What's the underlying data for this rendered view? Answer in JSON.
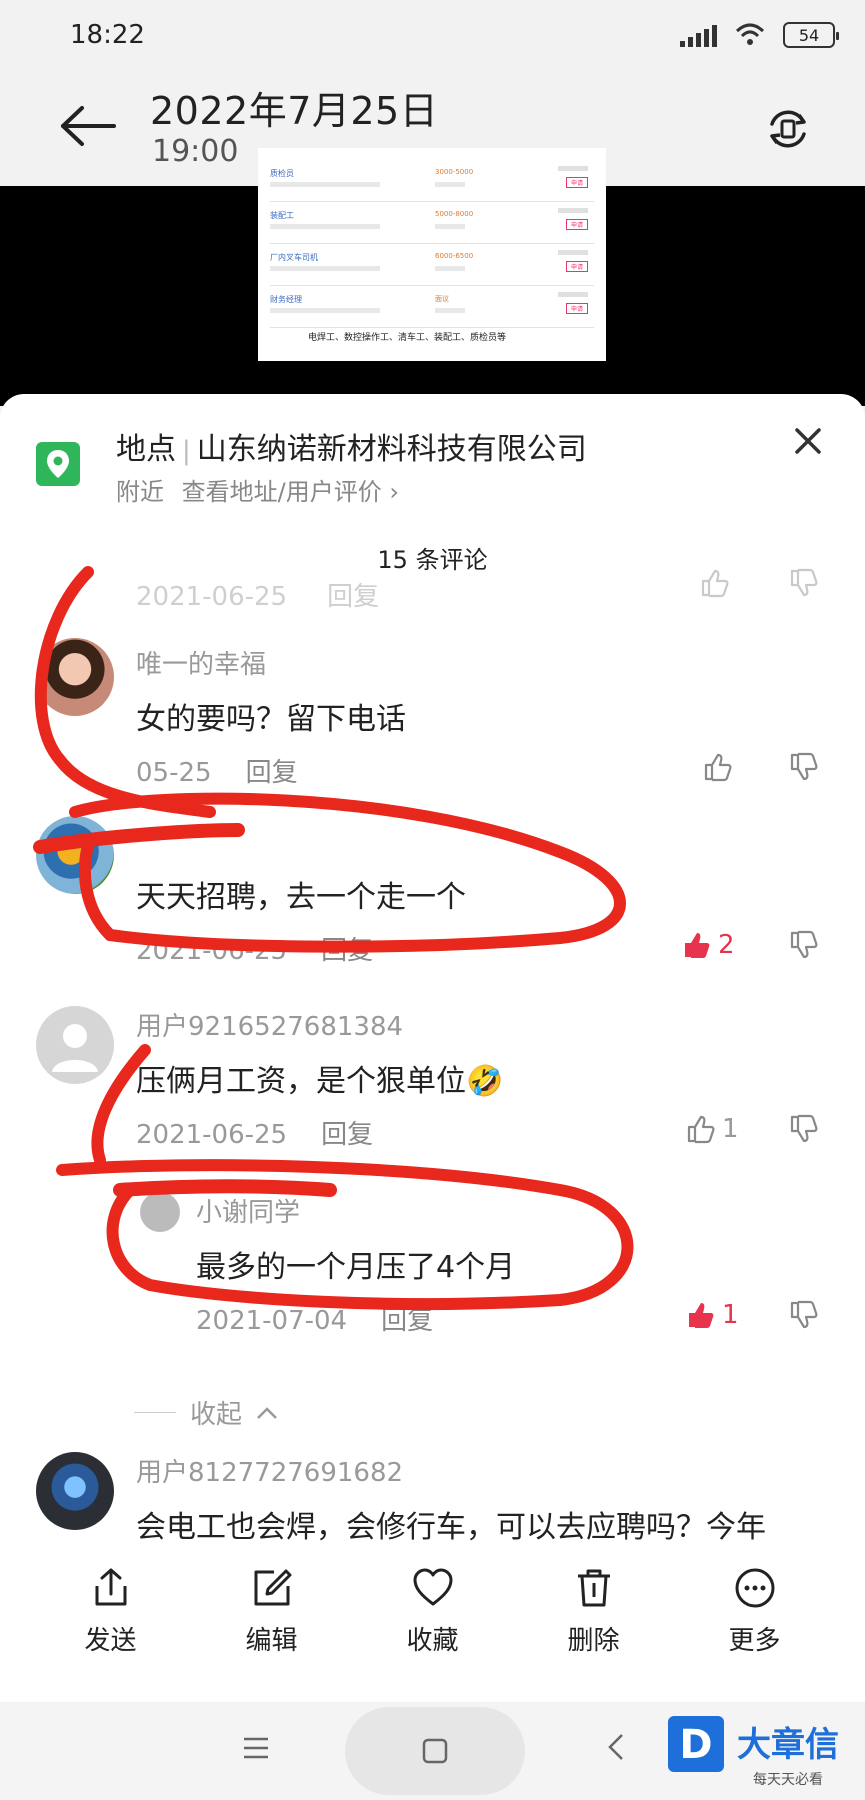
{
  "status_bar": {
    "time": "18:22",
    "battery": "54"
  },
  "header": {
    "title": "2022年7月25日",
    "subtitle": "19:00"
  },
  "thumbnail": {
    "rows": [
      {
        "title": "质检员",
        "salary": "3000-5000",
        "button": "申请"
      },
      {
        "title": "装配工",
        "salary": "5000-8000",
        "button": "申请"
      },
      {
        "title": "厂内叉车司机",
        "salary": "6000-6500",
        "button": "申请"
      },
      {
        "title": "财务经理",
        "salary": "面议",
        "button": "申请"
      }
    ],
    "caption": "电焊工、数控操作工、清车工、装配工、质检员等"
  },
  "location": {
    "label": "地点",
    "company": "山东纳诺新材料科技有限公司",
    "nearby": "附近",
    "link": "查看地址/用户评价 ›"
  },
  "comments": {
    "count_label": "15 条评论",
    "faded_meta": "2021-06-25",
    "faded_reply": "回复",
    "items": [
      {
        "user": "唯一的幸福",
        "text": "女的要吗？留下电话",
        "date": "05-25",
        "reply": "回复",
        "likes": ""
      },
      {
        "user": "",
        "text": "天天招聘，去一个走一个",
        "date": "2021-06-25",
        "reply": "回复",
        "likes": "2"
      },
      {
        "user": "用户9216527681384",
        "text": "压俩月工资，是个狠单位🤣",
        "date": "2021-06-25",
        "reply": "回复",
        "likes": "1"
      },
      {
        "user": "小谢同学",
        "text": "最多的一个月压了4个月",
        "date": "2021-07-04",
        "reply": "回复",
        "likes": "1"
      },
      {
        "user": "用户8127727691682",
        "text": "会电工也会焊，会修行车，可以去应聘吗？今年"
      }
    ],
    "collapse_label": "收起"
  },
  "actions": [
    {
      "label": "发送",
      "icon": "share-icon"
    },
    {
      "label": "编辑",
      "icon": "edit-icon"
    },
    {
      "label": "收藏",
      "icon": "heart-icon"
    },
    {
      "label": "删除",
      "icon": "trash-icon"
    },
    {
      "label": "更多",
      "icon": "more-icon"
    }
  ],
  "watermark": {
    "brand": "大章信",
    "tagline": "每天天必看"
  },
  "colors": {
    "accent_red": "#e8334f",
    "location_green": "#2fb55a",
    "annotation_red": "#e8281c"
  }
}
